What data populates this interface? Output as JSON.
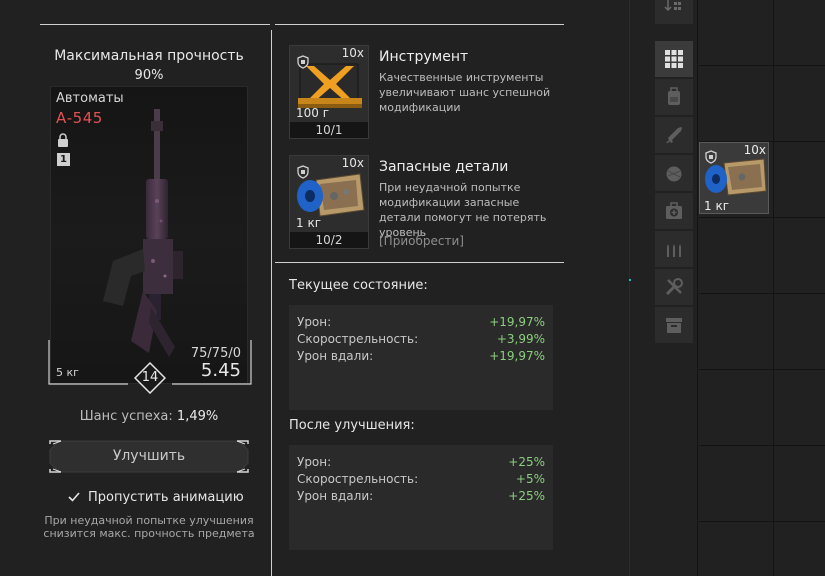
{
  "weapon": {
    "durability_title": "Максимальная прочность",
    "durability_value": "90%",
    "category": "Автоматы",
    "name": "А-545",
    "level": "1",
    "weight": "5 кг",
    "ammo": "75/75/0",
    "capacity": "5.45",
    "diamond_level": "14"
  },
  "chance": {
    "label": "Шанс успеха:",
    "value": "1,49%"
  },
  "upgrade_button": {
    "label": "Улучшить"
  },
  "skip_animation": {
    "label": "Пропустить анимацию",
    "checked": true
  },
  "warning": "При неудачной попытке улучшения снизится макс. прочность предмета",
  "materials": [
    {
      "title": "Инструмент",
      "description": "Качественные инструменты увеличивают шанс успешной модификации",
      "count": "10x",
      "qty": "100 г",
      "ratio": "10/1",
      "icon": "toolbox-icon"
    },
    {
      "title": "Запасные детали",
      "description": "При неудачной попытке модификации запасные детали помогут не потерять уровень",
      "count": "10x",
      "qty": "1 кг",
      "ratio": "10/2",
      "buy_label": "[Приобрести]",
      "icon": "spare-parts-icon"
    }
  ],
  "current": {
    "title": "Текущее состояние:",
    "stats": [
      {
        "label": "Урон:",
        "value": "+19,97%"
      },
      {
        "label": "Скорострельность:",
        "value": "+3,99%"
      },
      {
        "label": "Урон вдали:",
        "value": "+19,97%"
      }
    ]
  },
  "after": {
    "title": "После улучшения:",
    "stats": [
      {
        "label": "Урон:",
        "value": "+25%"
      },
      {
        "label": "Скорострельность:",
        "value": "+5%"
      },
      {
        "label": "Урон вдали:",
        "value": "+25%"
      }
    ]
  },
  "stash_item": {
    "count": "10x",
    "qty": "1 кг",
    "icon": "spare-parts-icon"
  },
  "sidebar": [
    {
      "icon": "sort-icon"
    },
    {
      "icon": "grid-icon",
      "active": true
    },
    {
      "icon": "backpack-icon"
    },
    {
      "icon": "rifle-icon"
    },
    {
      "icon": "grenade-icon"
    },
    {
      "icon": "medkit-icon"
    },
    {
      "icon": "ammo-icon"
    },
    {
      "icon": "tools-icon"
    },
    {
      "icon": "box-icon"
    }
  ],
  "colors": {
    "background": "#212121",
    "weapon_name": "#e25252",
    "stat_positive": "#8bcf7e",
    "accent_cyan": "#1fc0c0"
  }
}
